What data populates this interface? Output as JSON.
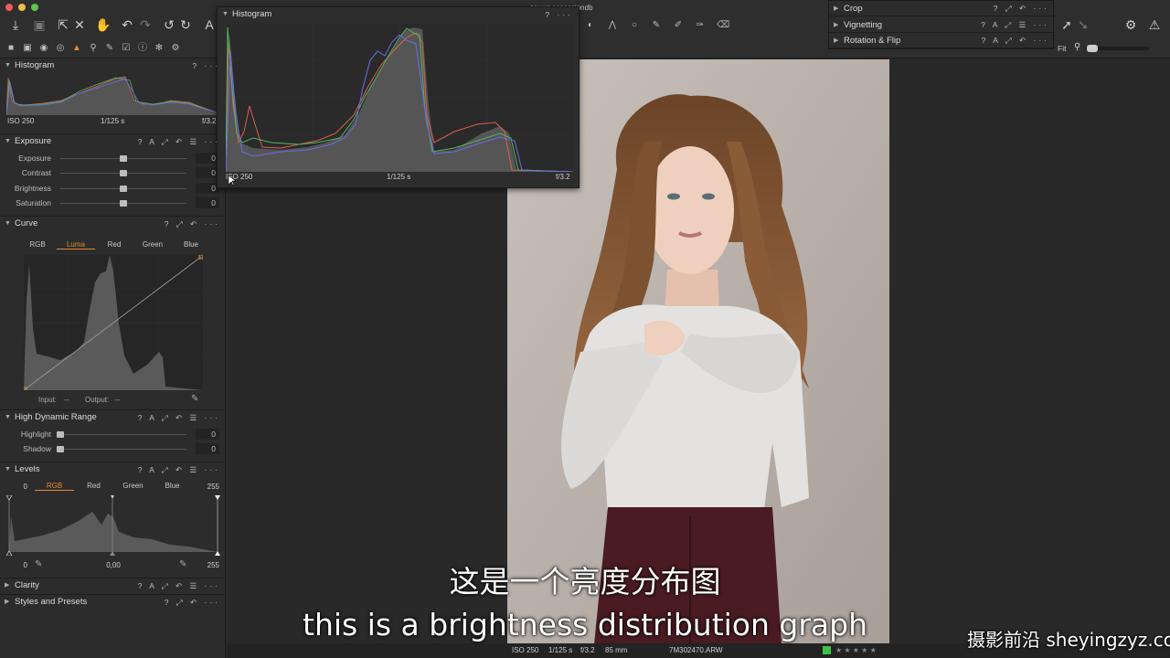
{
  "app": {
    "document_title": "вания.cosessiondb"
  },
  "left_panel": {
    "histogram": {
      "title": "Histogram",
      "controls": "? ···",
      "iso": "ISO 250",
      "shutter": "1/125 s",
      "aperture": "f/3.2"
    },
    "exposure": {
      "title": "Exposure",
      "controls": "? A ⤢ ↶ ☰ ···",
      "sliders": [
        {
          "label": "Exposure",
          "value": "0",
          "position": 0.5
        },
        {
          "label": "Contrast",
          "value": "0",
          "position": 0.5
        },
        {
          "label": "Brightness",
          "value": "0",
          "position": 0.5
        },
        {
          "label": "Saturation",
          "value": "0",
          "position": 0.5
        }
      ]
    },
    "curve": {
      "title": "Curve",
      "controls": "? ⤢ ↶ ···",
      "channels": [
        "RGB",
        "Luma",
        "Red",
        "Green",
        "Blue"
      ],
      "selected_channel": "Luma",
      "input_label": "Input:",
      "input_value": "--",
      "output_label": "Output:",
      "output_value": "--"
    },
    "hdr": {
      "title": "High Dynamic Range",
      "controls": "? A ⤢ ↶ ☰ ···",
      "sliders": [
        {
          "label": "Highlight",
          "value": "0",
          "position": 0.0
        },
        {
          "label": "Shadow",
          "value": "0",
          "position": 0.0
        }
      ]
    },
    "levels": {
      "title": "Levels",
      "controls": "? A ⤢ ↶ ☰ ···",
      "channels": [
        "RGB",
        "Red",
        "Green",
        "Blue"
      ],
      "selected_channel": "RGB",
      "input_low": "0",
      "input_high": "255",
      "output_low": "0",
      "midpoint": "0,00",
      "output_high": "255"
    },
    "clarity": {
      "title": "Clarity",
      "controls": "? A ⤢ ↶ ☰ ···"
    },
    "styles": {
      "title": "Styles and Presets",
      "controls": "? ⤢ ↶ ···"
    }
  },
  "floating_histogram": {
    "title": "Histogram",
    "controls": "? ···",
    "iso": "ISO 250",
    "shutter": "1/125 s",
    "aperture": "f/3.2"
  },
  "floating_tools": {
    "items": [
      {
        "label": "Crop",
        "controls": "? ⤢ ↶ ···"
      },
      {
        "label": "Vignetting",
        "controls": "? A ⤢ ☰ ···"
      },
      {
        "label": "Rotation & Flip",
        "controls": "? A ⤢ ↶ ···"
      }
    ]
  },
  "viewer": {
    "zoom_label": "Fit"
  },
  "status_bar": {
    "iso": "ISO 250",
    "shutter": "1/125 s",
    "aperture": "f/3.2",
    "focal": "85 mm",
    "filename": "7M302470.ARW",
    "rating": "★ ★ ★ ★ ★"
  },
  "subtitles": {
    "chinese": "这是一个亮度分布图",
    "english": "this is a brightness distribution graph"
  },
  "watermark": "摄影前沿 sheyingzyz.com",
  "colors": {
    "accent": "#e58a2d",
    "panel": "#2c2c2c",
    "background": "#292929"
  }
}
